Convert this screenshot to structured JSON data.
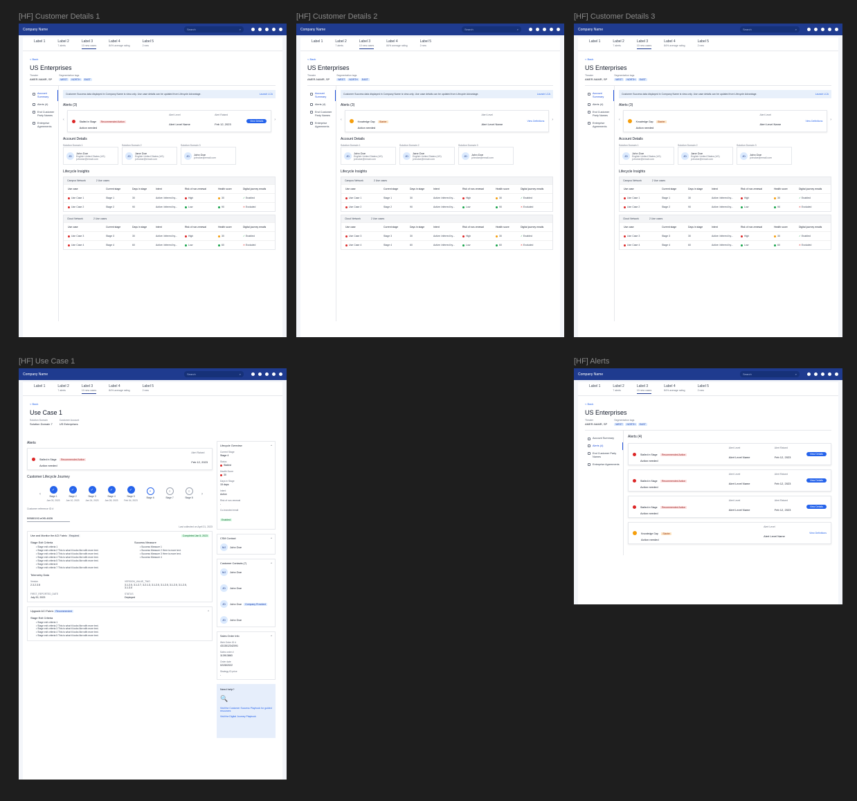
{
  "frames": {
    "cd1": "[HF] Customer Details 1",
    "cd2": "[HF] Customer Details 2",
    "cd3": "[HF] Customer Details 3",
    "uc1": "[HF] Use Case 1",
    "alerts": "[HF] Alerts"
  },
  "topbar": {
    "company": "Company Name",
    "search_placeholder": "Search"
  },
  "tabs": [
    {
      "label": "Label 1",
      "sub": ""
    },
    {
      "label": "Label 2",
      "sub": "7 alerts"
    },
    {
      "label": "Label 3",
      "sub": "10 new cases"
    },
    {
      "label": "Label 4",
      "sub": "84% average rating"
    },
    {
      "label": "Label 5",
      "sub": "2 new"
    }
  ],
  "customer": {
    "back": "< Back",
    "name": "US Enterprises",
    "theater_label": "Theater",
    "theater_value": "AMER-NAMR, SP",
    "seg_label": "Segmentation tags",
    "seg_tags": [
      "WEST",
      "NORTH",
      "EAST"
    ]
  },
  "nav": [
    "Account Summary",
    "Alerts (4)",
    "End Customer Party Names",
    "Enterprise Agreements"
  ],
  "info": {
    "text": "Customer Success data displayed in Company Name is view-only. Use case details can be updated from Lifecycle Advantage.",
    "link": "Launch LCA"
  },
  "alerts_section": {
    "title": "Alerts (3)",
    "stalled_type": "Stalled in Stage",
    "stalled_badge": "Recommended Action",
    "action": "Action needed",
    "level_label": "Alert Level",
    "level_value": "Alert Level Name",
    "date_label": "Alert Raised",
    "date_value": "Feb 12, 2023",
    "view_details": "View Details",
    "knowledge_type": "Knowledge Gap",
    "knowledge_badge": "Starter",
    "view_definitions": "View Definitions"
  },
  "account_details": {
    "title": "Account Details",
    "contacts": [
      {
        "domain": "Solution Domain 1",
        "initials": "JD",
        "name": "John Doe",
        "role": "English United States (US)",
        "email": "johndoe@email.com"
      },
      {
        "domain": "Solution Domain 2",
        "initials": "JD",
        "name": "Jane Doe",
        "role": "English United States (US)",
        "email": "johndoe@email.com"
      },
      {
        "domain": "Solution Domain 3",
        "initials": "JD",
        "name": "John Doe",
        "role": "",
        "email": "johndoe@email.com"
      }
    ]
  },
  "lifecycle": {
    "title": "Lifecycle Insights",
    "columns": [
      "Use case",
      "Current stage",
      "Days in stage",
      "Intent",
      "Risk of non-renewal",
      "Health score",
      "Digital journey emails"
    ],
    "groups": [
      {
        "name": "Campus Network",
        "count": "2 Use cases",
        "rows": [
          {
            "uc": "Use Case 1",
            "stage": "Stage 1",
            "days": "30",
            "intent": "Active: Inferred by...",
            "risk": "High",
            "health": "30",
            "email": "Enabled"
          },
          {
            "uc": "Use Case 2",
            "stage": "Stage 2",
            "days": "90",
            "intent": "Active: Inferred by...",
            "risk": "Low",
            "health": "90",
            "email": "Excluded"
          }
        ]
      },
      {
        "name": "Cloud Network",
        "count": "2 Use cases",
        "rows": [
          {
            "uc": "Use Case 3",
            "stage": "Stage 3",
            "days": "30",
            "intent": "Active: Inferred by...",
            "risk": "High",
            "health": "30",
            "email": "Enabled"
          },
          {
            "uc": "Use Case 4",
            "stage": "Stage 4",
            "days": "60",
            "intent": "Active: Inferred by...",
            "risk": "Low",
            "health": "60",
            "email": "Excluded"
          }
        ]
      }
    ]
  },
  "usecase": {
    "back": "< Back",
    "title": "Use Case 1",
    "domain_label": "Solution Domain",
    "domain_value": "Solution Domain 7",
    "account_label": "Customer Account",
    "account_value": "US Enterprises",
    "alerts_title": "Alerts",
    "journey_title": "Customer Lifecycle Journey",
    "stages": [
      "Stage 1",
      "Stage 2",
      "Stage 3",
      "Stage 4",
      "Stage 5",
      "Stage 6",
      "Stage 7",
      "Stage 8"
    ],
    "stage_dates": [
      "Jan 03, 2023",
      "Jan 10, 2023",
      "Jan 24, 2023",
      "Jan 28, 2023",
      "Feb 04, 2023",
      "",
      "",
      ""
    ],
    "ref_label": "Customer reference ID #",
    "ref_value": "59580192-e0f0-4826",
    "last_collected": "Last collected on April 21, 2023",
    "task1_title": "Use and Monitor the ACI Fabric",
    "task1_badge": "Required",
    "task1_status": "Completed Jan 5, 2023",
    "exit_title": "Stage Exit Criteria",
    "exit_items": [
      "Stage exit criteria 1",
      "Stage exit criteria 2 This is what it looks like with more text.",
      "Stage exit criteria 3 This is what it looks like with more text.",
      "Stage exit criteria 4 This is what it looks like with more text.",
      "Stage exit criteria 5 This is what it looks like with more text.",
      "Stage exit criteria 6",
      "Stage exit criteria 7 This is what it looks like with more text."
    ],
    "success_title": "Success Measure",
    "success_items": [
      "Success Measure 1",
      "Success Measure 2 Here is more text.",
      "Success Measure 3 Here is more text.",
      "Success Measure 4"
    ],
    "telemetry_title": "Telemetry Data",
    "version_label": "Version",
    "version_value": "2.3.2.3.5",
    "vv2_label": "VERSION_VALUE_TWO",
    "vv2_value": "3.1.2.0, 3.1.2.7, 3.2.1.3, 3.1.2.0, 3.1.2.0, 3.1.2.0, 3.1.2.0, 3.1.3.0",
    "fr_label": "FIRST_REPORTED_DATE",
    "fr_value": "July 20, 2023",
    "status_label": "STATUS",
    "status_value": "Deployed",
    "task2_title": "Upgrade ACI Fabric",
    "task2_badge": "Recommended",
    "exit2_items": [
      "Stage exit criteria 1",
      "Stage exit criteria 2 This is what it looks like with more text.",
      "Stage exit criteria 3 This is what it looks like with more text.",
      "Stage exit criteria 4 This is what it looks like with more text.",
      "Stage exit criteria 5 This is what it looks like with more text."
    ],
    "lo_title": "Lifecycle Overview",
    "lo_stage_label": "Current Stage",
    "lo_stage_value": "Stage 4",
    "lo_status_label": "Status",
    "lo_status_value": "Stalled",
    "lo_health_label": "Health Score",
    "lo_health_value": "30",
    "lo_days_label": "Days in Stage",
    "lo_days_value": "15 days",
    "lo_intent_label": "Intent",
    "lo_intent_value": "Active",
    "lo_risk_label": "Risk of non-renewal",
    "lo_risk_value": "-",
    "lo_email_label": "Co-branded email",
    "lo_email_value": "Enabled",
    "csm_title": "CSM Contact",
    "csm_initials": "MJ",
    "csm_name": "John Doe",
    "cc_title": "Customer Contacts (7)",
    "cc_initials": [
      "MJ",
      "JD",
      "JD",
      "JD"
    ],
    "cc_names": [
      "John Doe",
      "John Doe",
      "John Doe",
      "John Doe"
    ],
    "cc_badge": "Company Provided",
    "so_title": "Sales Order Info",
    "so_items": [
      {
        "k": "Web Order ID #",
        "v": "4313512342091"
      },
      {
        "k": "Sales order #",
        "v": "113913863"
      },
      {
        "k": "Order date",
        "v": "02/28/2022"
      },
      {
        "k": "Strategy ID price",
        "v": "-"
      }
    ],
    "help_title": "Need help?",
    "help_link1": "Visit the Customer Success Playbook for guided resources",
    "help_link2": "Visit the Digital Journey Playbook"
  },
  "alerts_page": {
    "title": "Alerts (4)"
  }
}
